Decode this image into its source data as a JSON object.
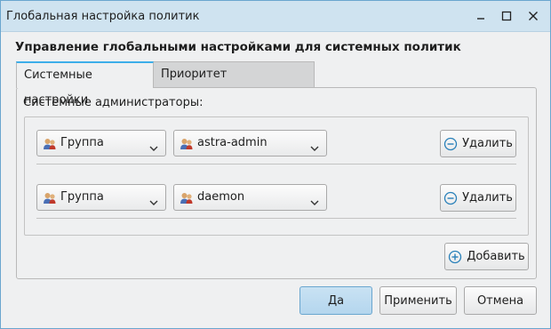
{
  "window": {
    "title": "Глобальная настройка политик",
    "controls": [
      "minimize-icon",
      "maximize-icon",
      "close-icon"
    ]
  },
  "heading": "Управление глобальными настройками для системных политик",
  "tabs": [
    {
      "label": "Системные настройки",
      "active": true
    },
    {
      "label": "Приоритет конфигурации",
      "active": false
    }
  ],
  "section_label": "Системные администраторы:",
  "rows": [
    {
      "type": "Группа",
      "value": "astra-admin",
      "remove_label": "Удалить"
    },
    {
      "type": "Группа",
      "value": "daemon",
      "remove_label": "Удалить"
    }
  ],
  "add_label": "Добавить",
  "footer": {
    "ok_label": "Да",
    "apply_label": "Применить",
    "cancel_label": "Отмена"
  },
  "colors": {
    "titlebar": "#cfe3f0",
    "accent": "#3daee9",
    "primary_button": "#b4d6ee"
  }
}
